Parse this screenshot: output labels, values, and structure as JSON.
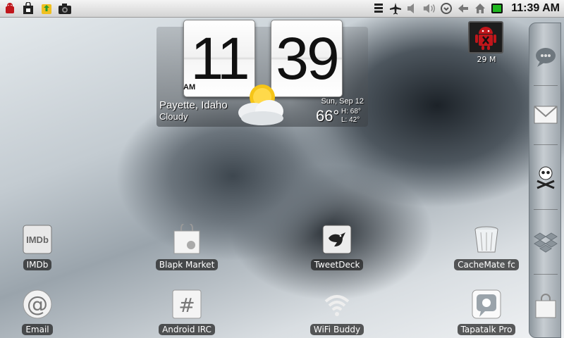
{
  "status_bar": {
    "time": "11:39 AM",
    "left_icons": [
      "android-debug-icon",
      "market-bag-icon",
      "app-update-icon",
      "camera-icon"
    ],
    "right_icons": [
      "signal-bars-icon",
      "airplane-icon",
      "volume-mute-icon",
      "volume-icon",
      "sync-icon",
      "back-arrow-icon",
      "home-icon",
      "battery-icon"
    ],
    "battery_color": "#1fb71f"
  },
  "clock_widget": {
    "hours": "11",
    "minutes": "39",
    "ampm": "AM",
    "city": "Payette, Idaho",
    "condition": "Cloudy",
    "date": "Sun, Sep 12",
    "temperature": "66°",
    "high": "H:  68°",
    "low": "L:  42°",
    "weather_icon": "partly-cloudy-icon"
  },
  "task_killer": {
    "memory": "29 M",
    "icon": "android-x-icon",
    "accent": "#c0161b"
  },
  "apps": [
    {
      "label": "IMDb",
      "icon": "imdb-icon"
    },
    {
      "label": "Blapk Market",
      "icon": "market-bag-icon"
    },
    {
      "label": "TweetDeck",
      "icon": "bird-icon"
    },
    {
      "label": "CacheMate fc",
      "icon": "trash-can-icon"
    },
    {
      "label": "Email",
      "icon": "at-sign-icon"
    },
    {
      "label": "Android IRC",
      "icon": "hash-icon"
    },
    {
      "label": "WiFi Buddy",
      "icon": "wifi-icon"
    },
    {
      "label": "Tapatalk Pro",
      "icon": "tapatalk-icon"
    }
  ],
  "dock": {
    "items": [
      "chat-bubble-icon",
      "gmail-envelope-icon",
      "skull-icon",
      "dropbox-icon",
      "market-bag-icon"
    ]
  }
}
